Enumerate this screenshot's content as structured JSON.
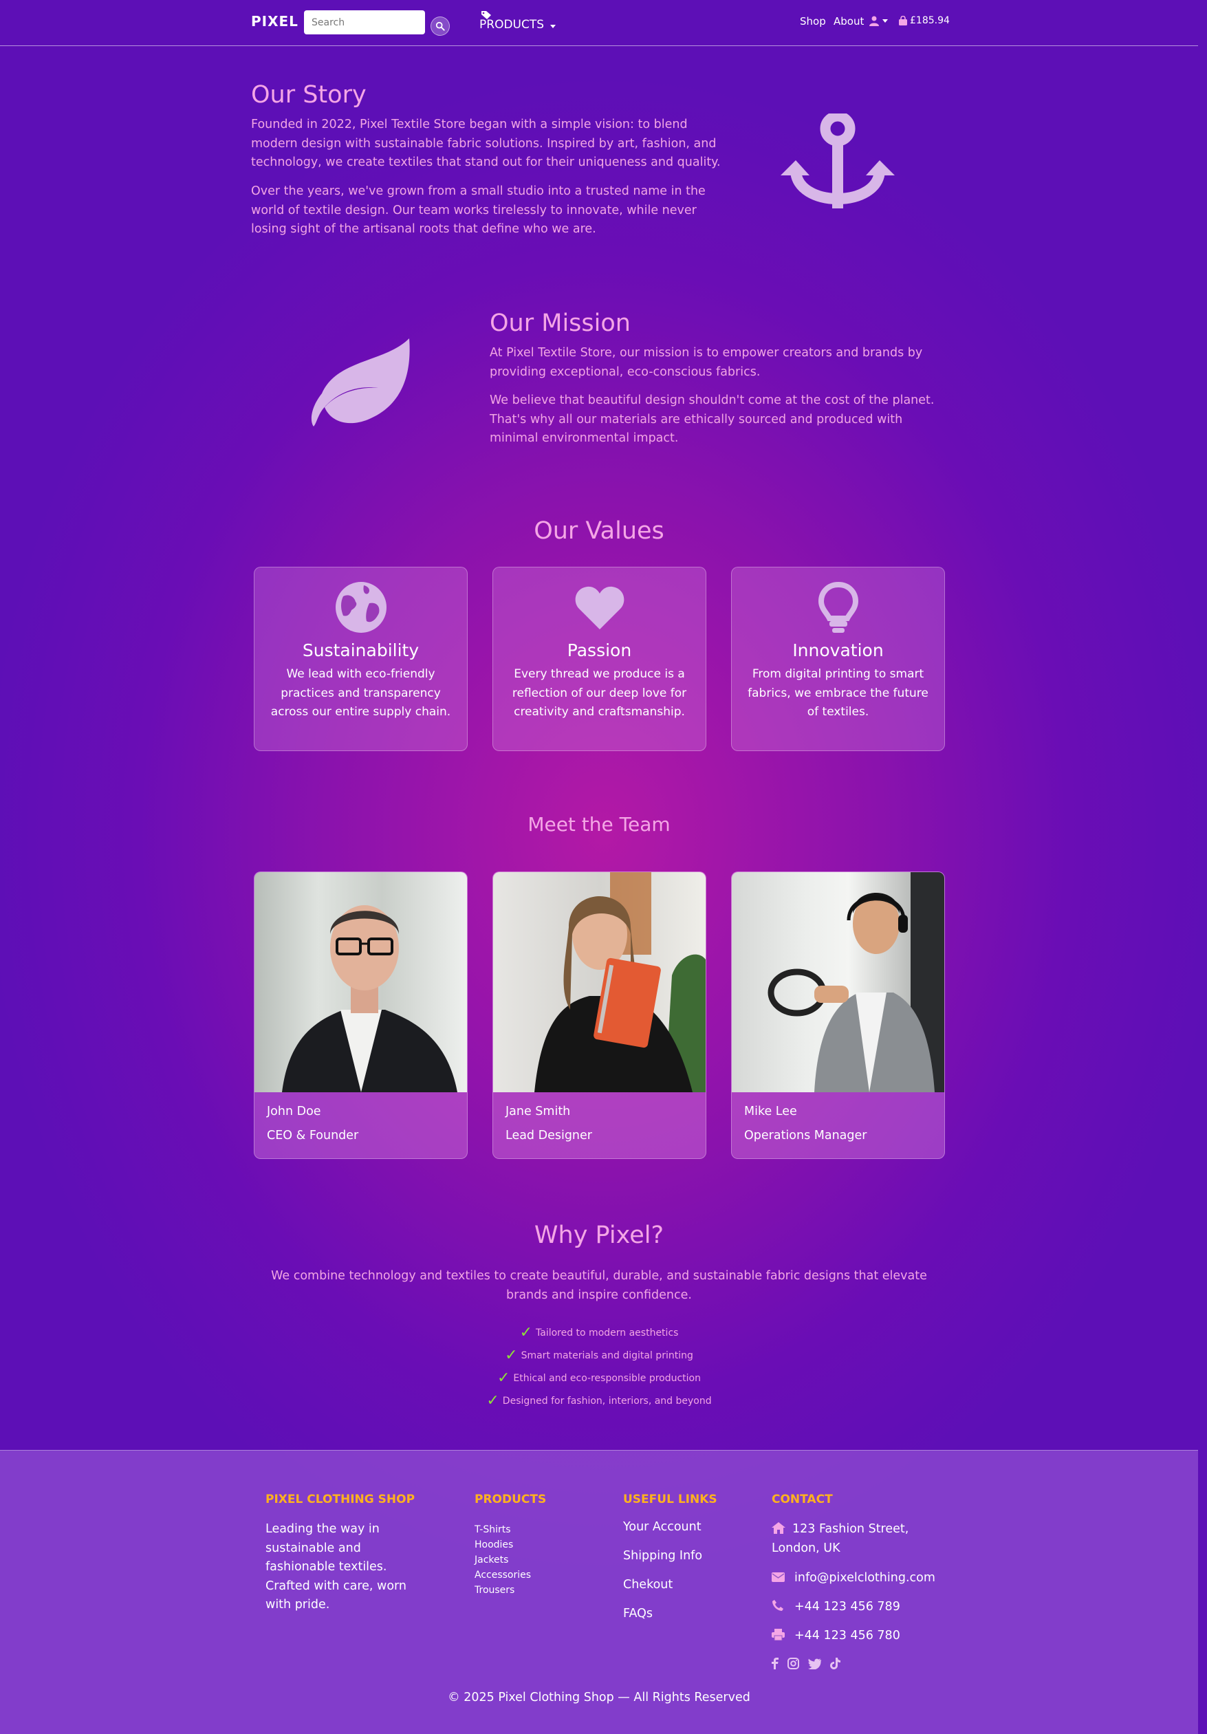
{
  "navbar": {
    "brand": "PIXEL",
    "search_placeholder": "Search",
    "products_label": "PRODUCTS",
    "shop_label": "Shop",
    "about_label": "About",
    "cart_total": "£185.94",
    "icons": [
      "search-icon",
      "tag-icon",
      "user-icon",
      "shopping-bag-icon"
    ]
  },
  "story": {
    "title": "Our Story",
    "p1": "Founded in 2022, Pixel Textile Store began with a simple vision: to blend modern design with sustainable fabric solutions. Inspired by art, fashion, and technology, we create textiles that stand out for their uniqueness and quality.",
    "p2": "Over the years, we've grown from a small studio into a trusted name in the world of textile design. Our team works tirelessly to innovate, while never losing sight of the artisanal roots that define who we are.",
    "icon": "anchor-icon"
  },
  "mission": {
    "title": "Our Mission",
    "p1": "At Pixel Textile Store, our mission is to empower creators and brands by providing exceptional, eco-conscious fabrics.",
    "p2": "We believe that beautiful design shouldn't come at the cost of the planet. That's why all our materials are ethically sourced and produced with minimal environmental impact.",
    "icon": "leaf-icon"
  },
  "values": {
    "title": "Our Values",
    "items": [
      {
        "title": "Sustainability",
        "text": "We lead with eco-friendly practices and transparency across our entire supply chain.",
        "icon": "globe-icon"
      },
      {
        "title": "Passion",
        "text": "Every thread we produce is a reflection of our deep love for creativity and craftsmanship.",
        "icon": "heart-icon"
      },
      {
        "title": "Innovation",
        "text": "From digital printing to smart fabrics, we embrace the future of textiles.",
        "icon": "lightbulb-icon"
      }
    ]
  },
  "team": {
    "title": "Meet the Team",
    "members": [
      {
        "name": "John Doe",
        "role": "CEO & Founder"
      },
      {
        "name": "Jane Smith",
        "role": "Lead Designer"
      },
      {
        "name": "Mike Lee",
        "role": "Operations Manager"
      }
    ]
  },
  "why": {
    "title": "Why Pixel?",
    "text": "We combine technology and textiles to create beautiful, durable, and sustainable fabric designs that elevate brands and inspire confidence.",
    "list": [
      "Tailored to modern aesthetics",
      "Smart materials and digital printing",
      "Ethical and eco-responsible production",
      "Designed for fashion, interiors, and beyond"
    ]
  },
  "footer": {
    "shop": {
      "heading": "PIXEL CLOTHING SHOP",
      "text": "Leading the way in sustainable and fashionable textiles. Crafted with care, worn with pride."
    },
    "products": {
      "heading": "PRODUCTS",
      "items": [
        "T-Shirts",
        "Hoodies",
        "Jackets",
        "Accessories",
        "Trousers"
      ]
    },
    "links": {
      "heading": "USEFUL LINKS",
      "items": [
        "Your Account",
        "Shipping Info",
        "Chekout",
        "FAQs"
      ]
    },
    "contact": {
      "heading": "CONTACT",
      "address": "123 Fashion Street, London, UK",
      "email": "info@pixelclothing.com",
      "phone": "+44 123 456 789",
      "fax": "+44 123 456 780"
    },
    "social": [
      "facebook-icon",
      "instagram-icon",
      "twitter-icon",
      "tiktok-icon"
    ],
    "copyright": "© 2025 Pixel Clothing Shop — All Rights Reserved"
  },
  "colors": {
    "accent_pink": "#f4a6e6",
    "footer_heading": "#ffb21e",
    "check_green": "#8fe03a",
    "icon_lilac": "#d8b6e8"
  }
}
